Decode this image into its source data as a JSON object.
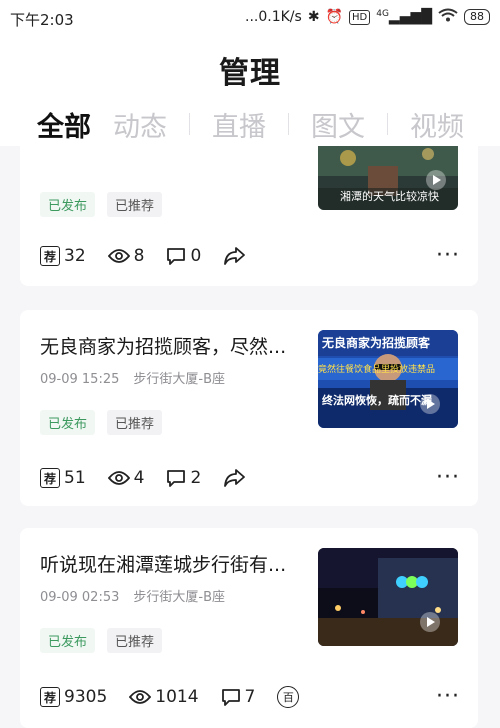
{
  "status_bar": {
    "time": "下午2:03",
    "network_speed": "...0.1K/s",
    "hd_label": "HD",
    "signal_label": "4G",
    "battery": "88"
  },
  "page_title": "管理",
  "tabs": [
    "全部",
    "动态",
    "直播",
    "图文",
    "视频"
  ],
  "posts": [
    {
      "title": "",
      "time": "",
      "location": "",
      "status": "已发布",
      "recommend": "已推荐",
      "thumb_text": "湘潭的天气比较凉快",
      "recommend_count": "32",
      "views": "8",
      "comments": "0"
    },
    {
      "title": "无良商家为招揽顾客，尽然...",
      "time": "09-09 15:25",
      "location": "步行街大厦-B座",
      "status": "已发布",
      "recommend": "已推荐",
      "thumb_text": "无良商家为招揽顾客",
      "thumb_sub1": "竟然往餐饮食品里投放违禁品",
      "thumb_sub2": "终法网恢恢，疏而不漏",
      "recommend_count": "51",
      "views": "4",
      "comments": "2"
    },
    {
      "title": "听说现在湘潭莲城步行街有...",
      "time": "09-09 02:53",
      "location": "步行街大厦-B座",
      "status": "已发布",
      "recommend": "已推荐",
      "thumb_text": "",
      "recommend_count": "9305",
      "views": "1014",
      "comments": "7"
    }
  ],
  "icons": {
    "recommend": "荐",
    "hundred": "百"
  },
  "colors": {
    "green_tag": "#3c9a5f",
    "inactive_tab": "#c7c7cc"
  }
}
